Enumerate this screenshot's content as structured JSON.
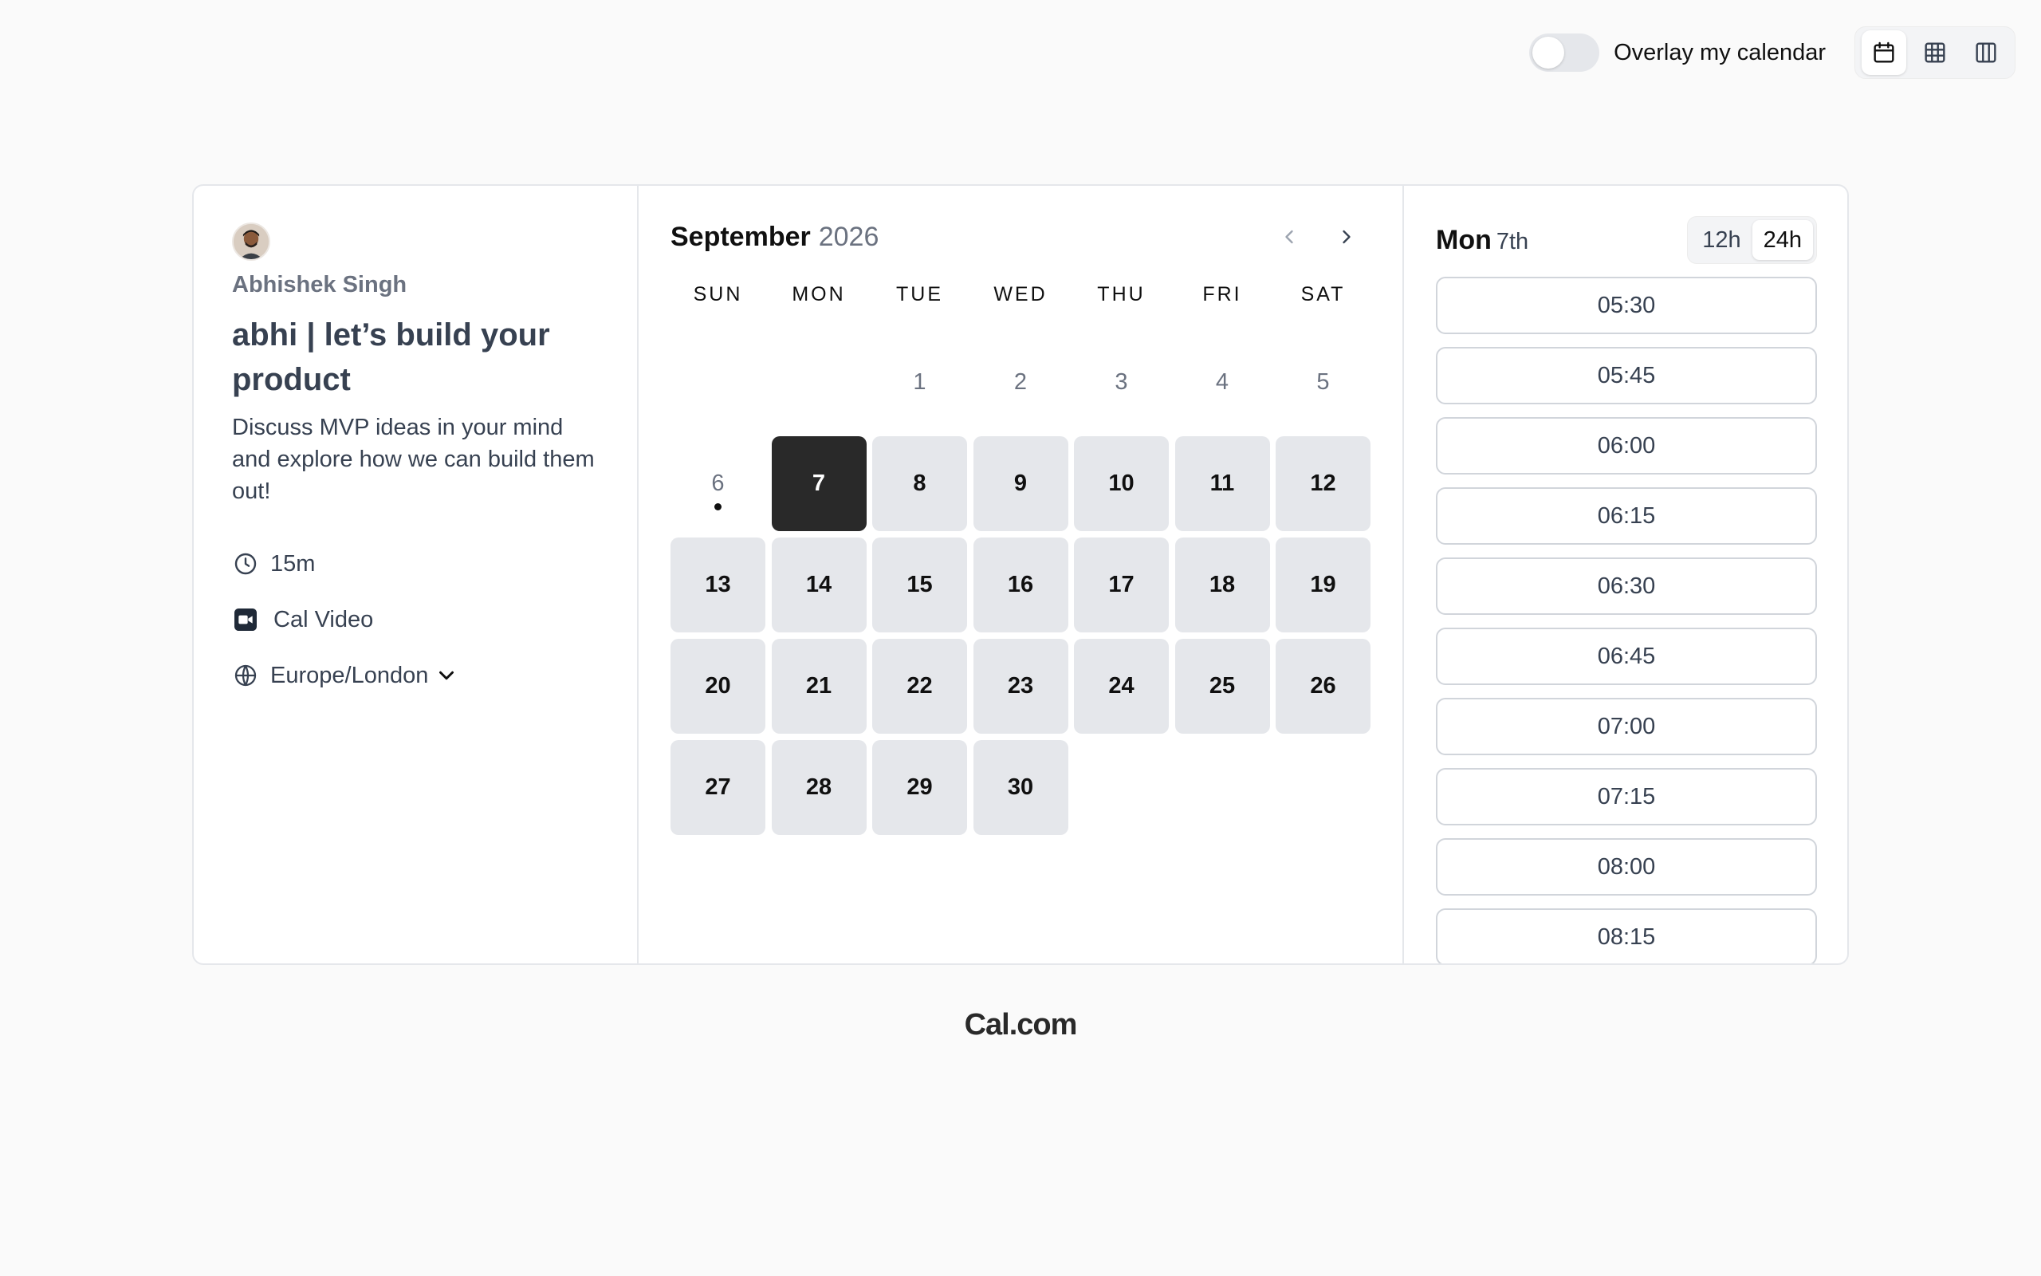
{
  "toolbar": {
    "overlay_label": "Overlay my calendar",
    "overlay_enabled": false,
    "views": [
      {
        "name": "month-view",
        "icon": "calendar-icon",
        "active": true
      },
      {
        "name": "week-view",
        "icon": "grid-icon",
        "active": false
      },
      {
        "name": "column-view",
        "icon": "columns-icon",
        "active": false
      }
    ]
  },
  "event": {
    "host_name": "Abhishek Singh",
    "title": "abhi | let’s build your product",
    "description": "Discuss MVP ideas in your mind and explore how we can build them out!",
    "duration": "15m",
    "location": "Cal Video",
    "timezone": "Europe/London"
  },
  "calendar": {
    "month": "September",
    "year": "2026",
    "weekdays": [
      "SUN",
      "MON",
      "TUE",
      "WED",
      "THU",
      "FRI",
      "SAT"
    ],
    "leading_blanks": 2,
    "days": [
      {
        "day": "1",
        "state": "disabled"
      },
      {
        "day": "2",
        "state": "disabled"
      },
      {
        "day": "3",
        "state": "disabled"
      },
      {
        "day": "4",
        "state": "disabled"
      },
      {
        "day": "5",
        "state": "disabled"
      },
      {
        "day": "6",
        "state": "today"
      },
      {
        "day": "7",
        "state": "selected"
      },
      {
        "day": "8",
        "state": "available"
      },
      {
        "day": "9",
        "state": "available"
      },
      {
        "day": "10",
        "state": "available"
      },
      {
        "day": "11",
        "state": "available"
      },
      {
        "day": "12",
        "state": "available"
      },
      {
        "day": "13",
        "state": "available"
      },
      {
        "day": "14",
        "state": "available"
      },
      {
        "day": "15",
        "state": "available"
      },
      {
        "day": "16",
        "state": "available"
      },
      {
        "day": "17",
        "state": "available"
      },
      {
        "day": "18",
        "state": "available"
      },
      {
        "day": "19",
        "state": "available"
      },
      {
        "day": "20",
        "state": "available"
      },
      {
        "day": "21",
        "state": "available"
      },
      {
        "day": "22",
        "state": "available"
      },
      {
        "day": "23",
        "state": "available"
      },
      {
        "day": "24",
        "state": "available"
      },
      {
        "day": "25",
        "state": "available"
      },
      {
        "day": "26",
        "state": "available"
      },
      {
        "day": "27",
        "state": "available"
      },
      {
        "day": "28",
        "state": "available"
      },
      {
        "day": "29",
        "state": "available"
      },
      {
        "day": "30",
        "state": "available"
      }
    ]
  },
  "slots": {
    "weekday": "Mon",
    "day": "7th",
    "format_options": [
      "12h",
      "24h"
    ],
    "active_format": "24h",
    "times": [
      "05:30",
      "05:45",
      "06:00",
      "06:15",
      "06:30",
      "06:45",
      "07:00",
      "07:15",
      "08:00",
      "08:15"
    ]
  },
  "footer": {
    "brand": "Cal.com"
  }
}
